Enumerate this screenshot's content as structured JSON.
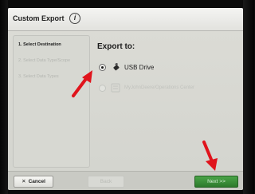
{
  "window": {
    "title": "Custom Export"
  },
  "sidebar": {
    "steps": [
      {
        "label": "1. Select Destination",
        "state": "active"
      },
      {
        "label": "2. Select Data Type/Scope",
        "state": "inactive"
      },
      {
        "label": "3. Select Data Types",
        "state": "inactive"
      }
    ]
  },
  "main": {
    "heading": "Export to:",
    "options": [
      {
        "label": "USB Drive",
        "selected": true,
        "enabled": true,
        "icon": "usb-drive-icon"
      },
      {
        "label": "MyJohnDeere/Operations Center",
        "selected": false,
        "enabled": false,
        "icon": "hard-drive-icon"
      }
    ]
  },
  "footer": {
    "cancel_label": "Cancel",
    "back_label": "Back",
    "next_label": "Next >>"
  },
  "colors": {
    "screen_bg": "#d3d4ce",
    "accent_green": "#2d7a2c",
    "annotation_red": "#e0141c"
  }
}
